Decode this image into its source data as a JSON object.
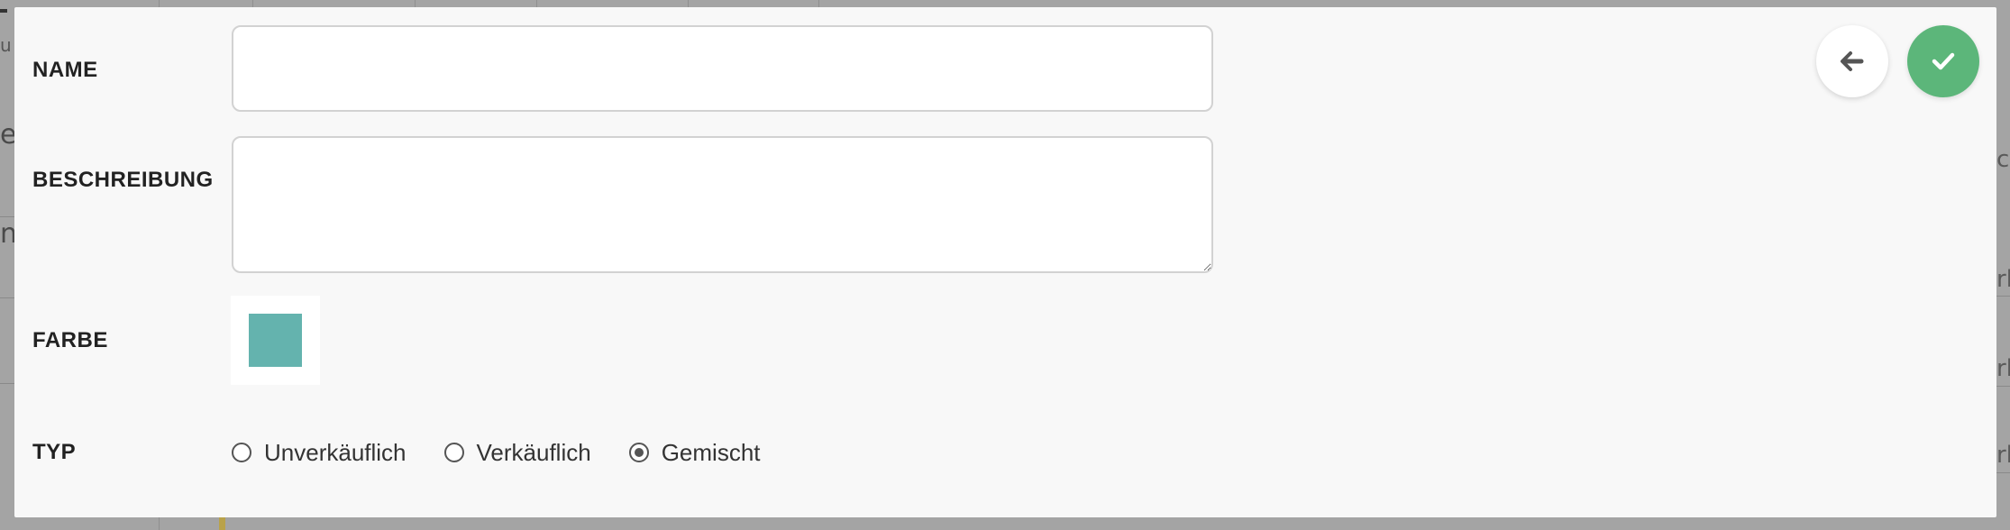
{
  "background": {
    "fragments_left": [
      "u",
      "e",
      "n"
    ],
    "fragments_right": [
      "ch",
      "rb",
      "rb",
      "rb"
    ]
  },
  "form": {
    "name": {
      "label": "NAME",
      "value": ""
    },
    "description": {
      "label": "BESCHREIBUNG",
      "value": ""
    },
    "color": {
      "label": "FARBE",
      "value": "#64b3ae"
    },
    "type": {
      "label": "TYP",
      "options": [
        "Unverkäuflich",
        "Verkäuflich",
        "Gemischt"
      ],
      "selected": "Gemischt"
    }
  },
  "actions": {
    "back_icon": "arrow-left-icon",
    "confirm_icon": "check-icon"
  },
  "colors": {
    "confirm": "#5cb67a",
    "swatch": "#64b3ae"
  }
}
